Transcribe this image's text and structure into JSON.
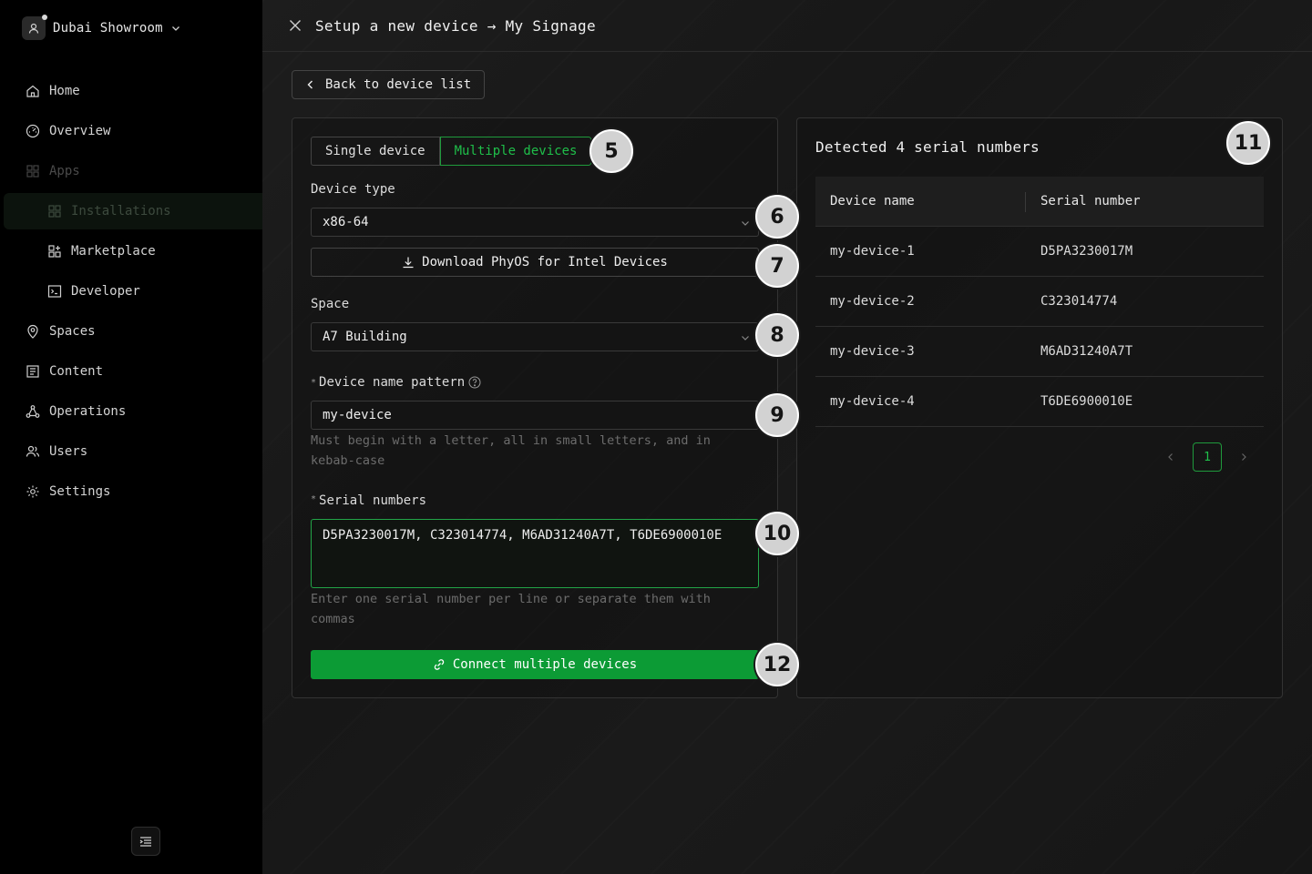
{
  "org": {
    "name": "Dubai Showroom"
  },
  "sidebar": {
    "items": [
      {
        "label": "Home",
        "icon": "home-icon"
      },
      {
        "label": "Overview",
        "icon": "gauge-icon"
      },
      {
        "label": "Apps",
        "icon": "apps-icon"
      },
      {
        "label": "Installations",
        "icon": "grid-icon"
      },
      {
        "label": "Marketplace",
        "icon": "marketplace-icon"
      },
      {
        "label": "Developer",
        "icon": "terminal-icon"
      },
      {
        "label": "Spaces",
        "icon": "map-pin-icon"
      },
      {
        "label": "Content",
        "icon": "content-icon"
      },
      {
        "label": "Operations",
        "icon": "operations-icon"
      },
      {
        "label": "Users",
        "icon": "users-icon"
      },
      {
        "label": "Settings",
        "icon": "gear-icon"
      }
    ]
  },
  "topbar": {
    "title": "Setup a new device → My Signage"
  },
  "back": {
    "label": "Back to device list"
  },
  "form": {
    "mode_single": "Single device",
    "mode_multiple": "Multiple devices",
    "device_type_label": "Device type",
    "device_type_value": "x86-64",
    "download_label": "Download PhyOS for Intel Devices",
    "space_label": "Space",
    "space_value": "A7 Building",
    "required_mark": "*",
    "name_pattern_label": "Device name pattern",
    "name_pattern_value": "my-device",
    "name_pattern_help": "Must begin with a letter, all in small letters, and in kebab-case",
    "serials_label": "Serial numbers",
    "serials_value": "D5PA3230017M, C323014774, M6AD31240A7T, T6DE6900010E",
    "serials_help": "Enter one serial number per line or separate them with commas",
    "connect_label": "Connect multiple devices"
  },
  "detected": {
    "title": "Detected 4 serial numbers",
    "columns": [
      "Device name",
      "Serial number"
    ],
    "rows": [
      [
        "my-device-1",
        "D5PA3230017M"
      ],
      [
        "my-device-2",
        "C323014774"
      ],
      [
        "my-device-3",
        "M6AD31240A7T"
      ],
      [
        "my-device-4",
        "T6DE6900010E"
      ]
    ],
    "page": "1"
  },
  "badges": [
    "5",
    "6",
    "7",
    "8",
    "9",
    "10",
    "11",
    "12"
  ],
  "colors": {
    "accent": "#0c9b35",
    "accent_text": "#1fbf4a",
    "background": "#000000",
    "panel": "#1a1a1a"
  }
}
